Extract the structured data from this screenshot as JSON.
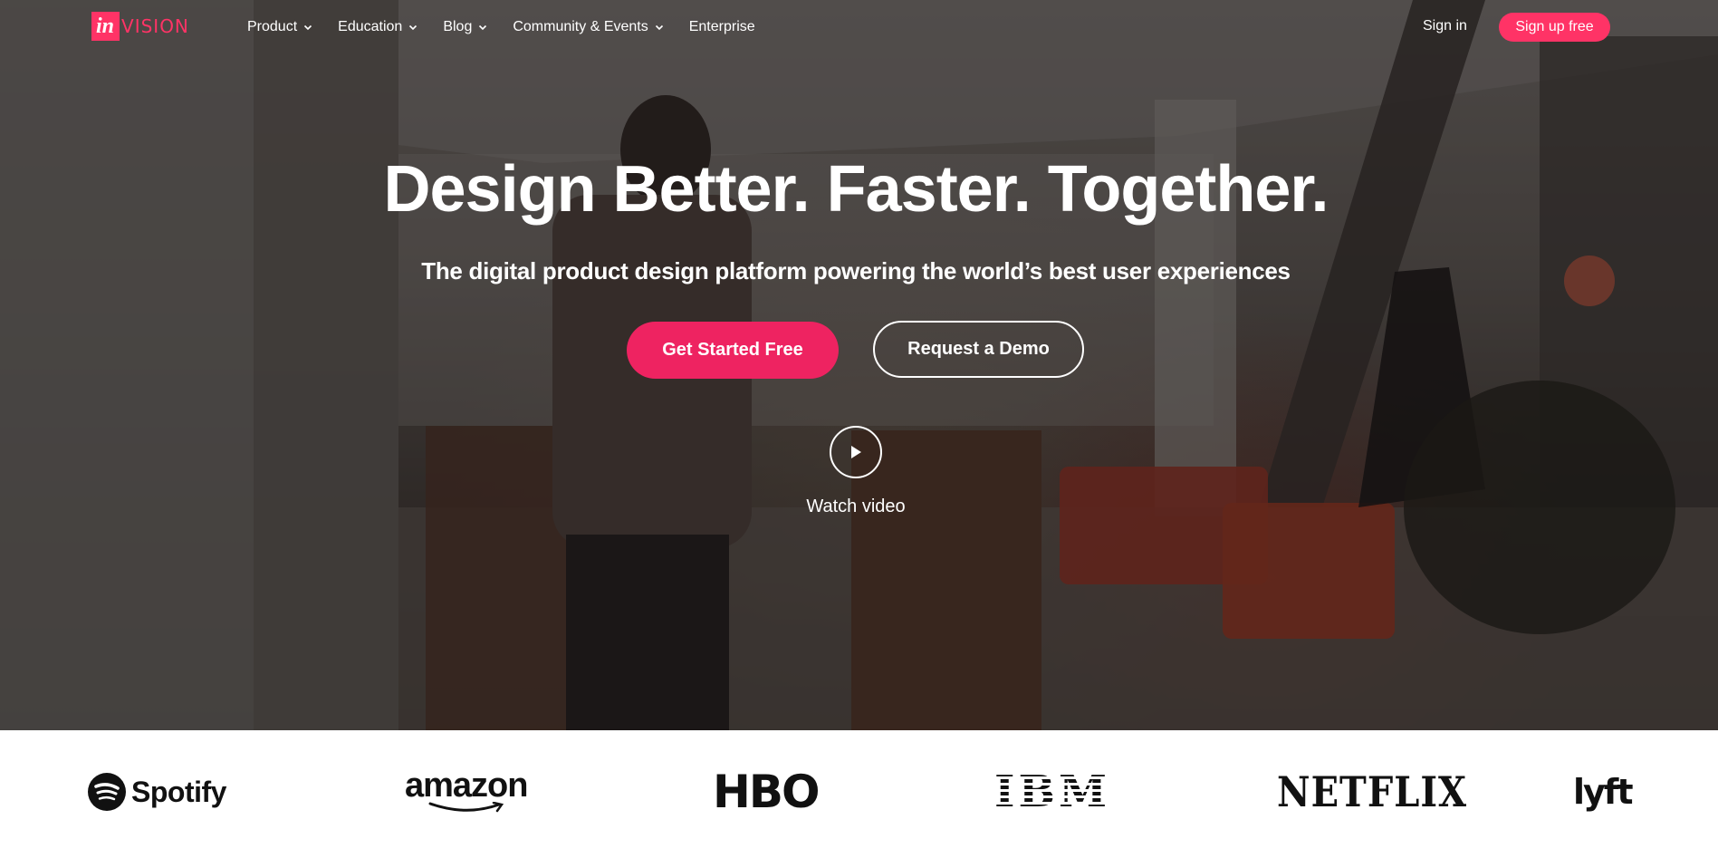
{
  "brand": {
    "logo_prefix": "in",
    "logo_suffix": "VISION",
    "accent_color": "#ff3366"
  },
  "nav": {
    "items": [
      {
        "label": "Product",
        "has_dropdown": true
      },
      {
        "label": "Education",
        "has_dropdown": true
      },
      {
        "label": "Blog",
        "has_dropdown": true
      },
      {
        "label": "Community & Events",
        "has_dropdown": true
      },
      {
        "label": "Enterprise",
        "has_dropdown": false
      }
    ],
    "sign_in": "Sign in",
    "sign_up": "Sign up free"
  },
  "hero": {
    "headline": "Design Better. Faster. Together.",
    "subheadline": "The digital product design platform powering the world’s best user experiences",
    "primary_cta": "Get Started Free",
    "secondary_cta": "Request a Demo",
    "video_label": "Watch video",
    "play_icon": "play-icon"
  },
  "clients": {
    "logos": [
      {
        "name": "Spotify",
        "icon": "spotify-icon"
      },
      {
        "name": "amazon"
      },
      {
        "name": "HBO"
      },
      {
        "name": "IBM"
      },
      {
        "name": "NETFLIX"
      },
      {
        "name": "lyft"
      }
    ]
  }
}
